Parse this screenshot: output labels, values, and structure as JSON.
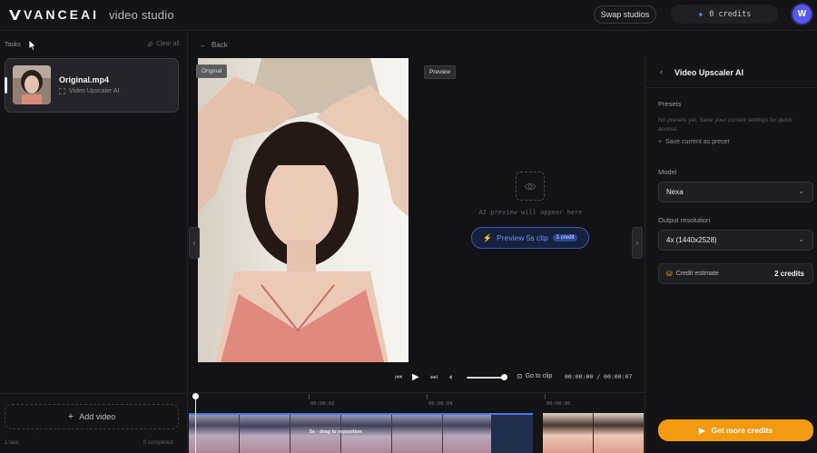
{
  "header": {
    "brand": "VANCEAI",
    "product": "video studio",
    "swap_label": "Swap studios",
    "credits_text": "0 credits",
    "avatar_initial": "W"
  },
  "tasks": {
    "heading": "Tasks",
    "clear_all": "Clear all",
    "items": [
      {
        "name": "Original.mp4",
        "tool": "Video Upscaler AI"
      }
    ],
    "add_video": "Add video",
    "footer_count": "1 task",
    "footer_status": "0 completed"
  },
  "workspace": {
    "back": "Back",
    "original_tag": "Original",
    "preview_tag": "Preview",
    "placeholder": "AI preview will appear here",
    "preview_btn": "Preview 5s clip",
    "preview_cost": "1 credit"
  },
  "player": {
    "goto_clip": "Go to clip",
    "timecode": "00:00:00 / 00:00:07",
    "volume_level": 0.85
  },
  "timeline": {
    "ticks": [
      "00:00:02",
      "00:00:04",
      "00:00:06"
    ],
    "drag_hint": "5s · drag to reposition"
  },
  "panel": {
    "title": "Video Upscaler AI",
    "presets_label": "Presets",
    "presets_empty": "No presets yet. Save your current settings for quick access.",
    "save_preset": "Save current as preset",
    "model_label": "Model",
    "model_value": "Nexa",
    "resolution_label": "Output resolution",
    "resolution_value": "4x (1440x2528)",
    "estimate_label": "Credit estimate",
    "estimate_value": "2 credits",
    "cta": "Get more credits"
  },
  "colors": {
    "accent_blue": "#5a57f0",
    "preview_blue": "#6f95ff",
    "cta_orange": "#f39a12",
    "background": "#131316"
  }
}
